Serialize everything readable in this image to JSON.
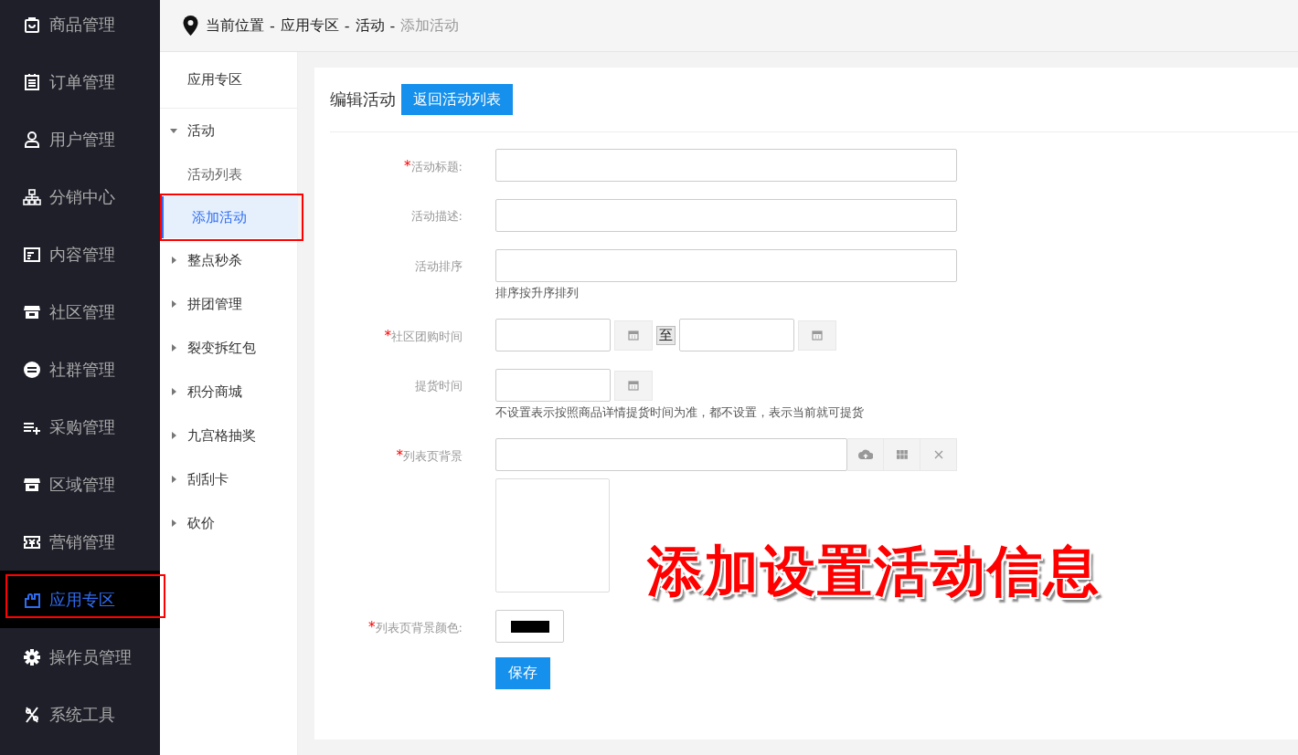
{
  "sidebar": {
    "items": [
      {
        "label": "商品管理",
        "selected": false,
        "highlighted": false
      },
      {
        "label": "订单管理",
        "selected": false,
        "highlighted": false
      },
      {
        "label": "用户管理",
        "selected": false,
        "highlighted": false
      },
      {
        "label": "分销中心",
        "selected": false,
        "highlighted": false
      },
      {
        "label": "内容管理",
        "selected": false,
        "highlighted": false
      },
      {
        "label": "社区管理",
        "selected": false,
        "highlighted": false
      },
      {
        "label": "社群管理",
        "selected": false,
        "highlighted": false
      },
      {
        "label": "采购管理",
        "selected": false,
        "highlighted": false
      },
      {
        "label": "区域管理",
        "selected": false,
        "highlighted": false
      },
      {
        "label": "营销管理",
        "selected": false,
        "highlighted": false
      },
      {
        "label": "应用专区",
        "selected": true,
        "highlighted": true
      },
      {
        "label": "操作员管理",
        "selected": false,
        "highlighted": false
      },
      {
        "label": "系统工具",
        "selected": false,
        "highlighted": false
      }
    ]
  },
  "breadcrumb": {
    "separator": "-",
    "items": [
      {
        "label": "当前位置",
        "current": false
      },
      {
        "label": "应用专区",
        "current": false
      },
      {
        "label": "活动",
        "current": false
      },
      {
        "label": "添加活动",
        "current": true
      }
    ]
  },
  "submenu": {
    "title": "应用专区",
    "groups": [
      {
        "label": "活动",
        "expanded": true,
        "children": [
          {
            "label": "活动列表",
            "selected": false,
            "highlighted": false
          },
          {
            "label": "添加活动",
            "selected": true,
            "highlighted": true
          }
        ]
      },
      {
        "label": "整点秒杀",
        "expanded": false
      },
      {
        "label": "拼团管理",
        "expanded": false
      },
      {
        "label": "裂变拆红包",
        "expanded": false
      },
      {
        "label": "积分商城",
        "expanded": false
      },
      {
        "label": "九宫格抽奖",
        "expanded": false
      },
      {
        "label": "刮刮卡",
        "expanded": false
      },
      {
        "label": "砍价",
        "expanded": false
      }
    ]
  },
  "card": {
    "title": "编辑活动",
    "back_button": "返回活动列表",
    "fields": [
      {
        "kind": "text",
        "label": "活动标题:",
        "required": true
      },
      {
        "kind": "text",
        "label": "活动描述:",
        "required": false
      },
      {
        "kind": "text",
        "label": "活动排序",
        "required": false,
        "hint": "排序按升序排列"
      },
      {
        "kind": "daterange",
        "label": "社区团购时间",
        "required": true,
        "joiner": "至"
      },
      {
        "kind": "date",
        "label": "提货时间",
        "required": false,
        "hint": "不设置表示按照商品详情提货时间为准，都不设置，表示当前就可提货"
      },
      {
        "kind": "image",
        "label": "列表页背景",
        "required": true
      },
      {
        "kind": "color",
        "label": "列表页背景颜色:",
        "required": true,
        "color": "#000000"
      }
    ],
    "save_button": "保存",
    "required_mark": "*"
  },
  "annotation": "添加设置活动信息"
}
